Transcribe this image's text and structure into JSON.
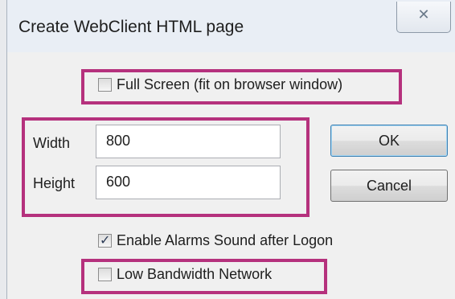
{
  "window": {
    "title": "Create WebClient HTML page",
    "close_glyph": "✕",
    "close_icon": "close-icon"
  },
  "options": {
    "full_screen": {
      "label": "Full Screen (fit on browser window)",
      "checked": false
    },
    "alarms_sound": {
      "label": "Enable Alarms Sound after Logon",
      "checked": true
    },
    "low_bandwidth": {
      "label": "Low Bandwidth Network",
      "checked": false
    }
  },
  "size": {
    "width_label": "Width",
    "width_value": "800",
    "height_label": "Height",
    "height_value": "600"
  },
  "buttons": {
    "ok": "OK",
    "cancel": "Cancel"
  },
  "check_glyph": "✓",
  "colors": {
    "highlight": "#b5317d",
    "titlebar": "#e9eef5",
    "dialog_bg": "#f0f0f0"
  }
}
